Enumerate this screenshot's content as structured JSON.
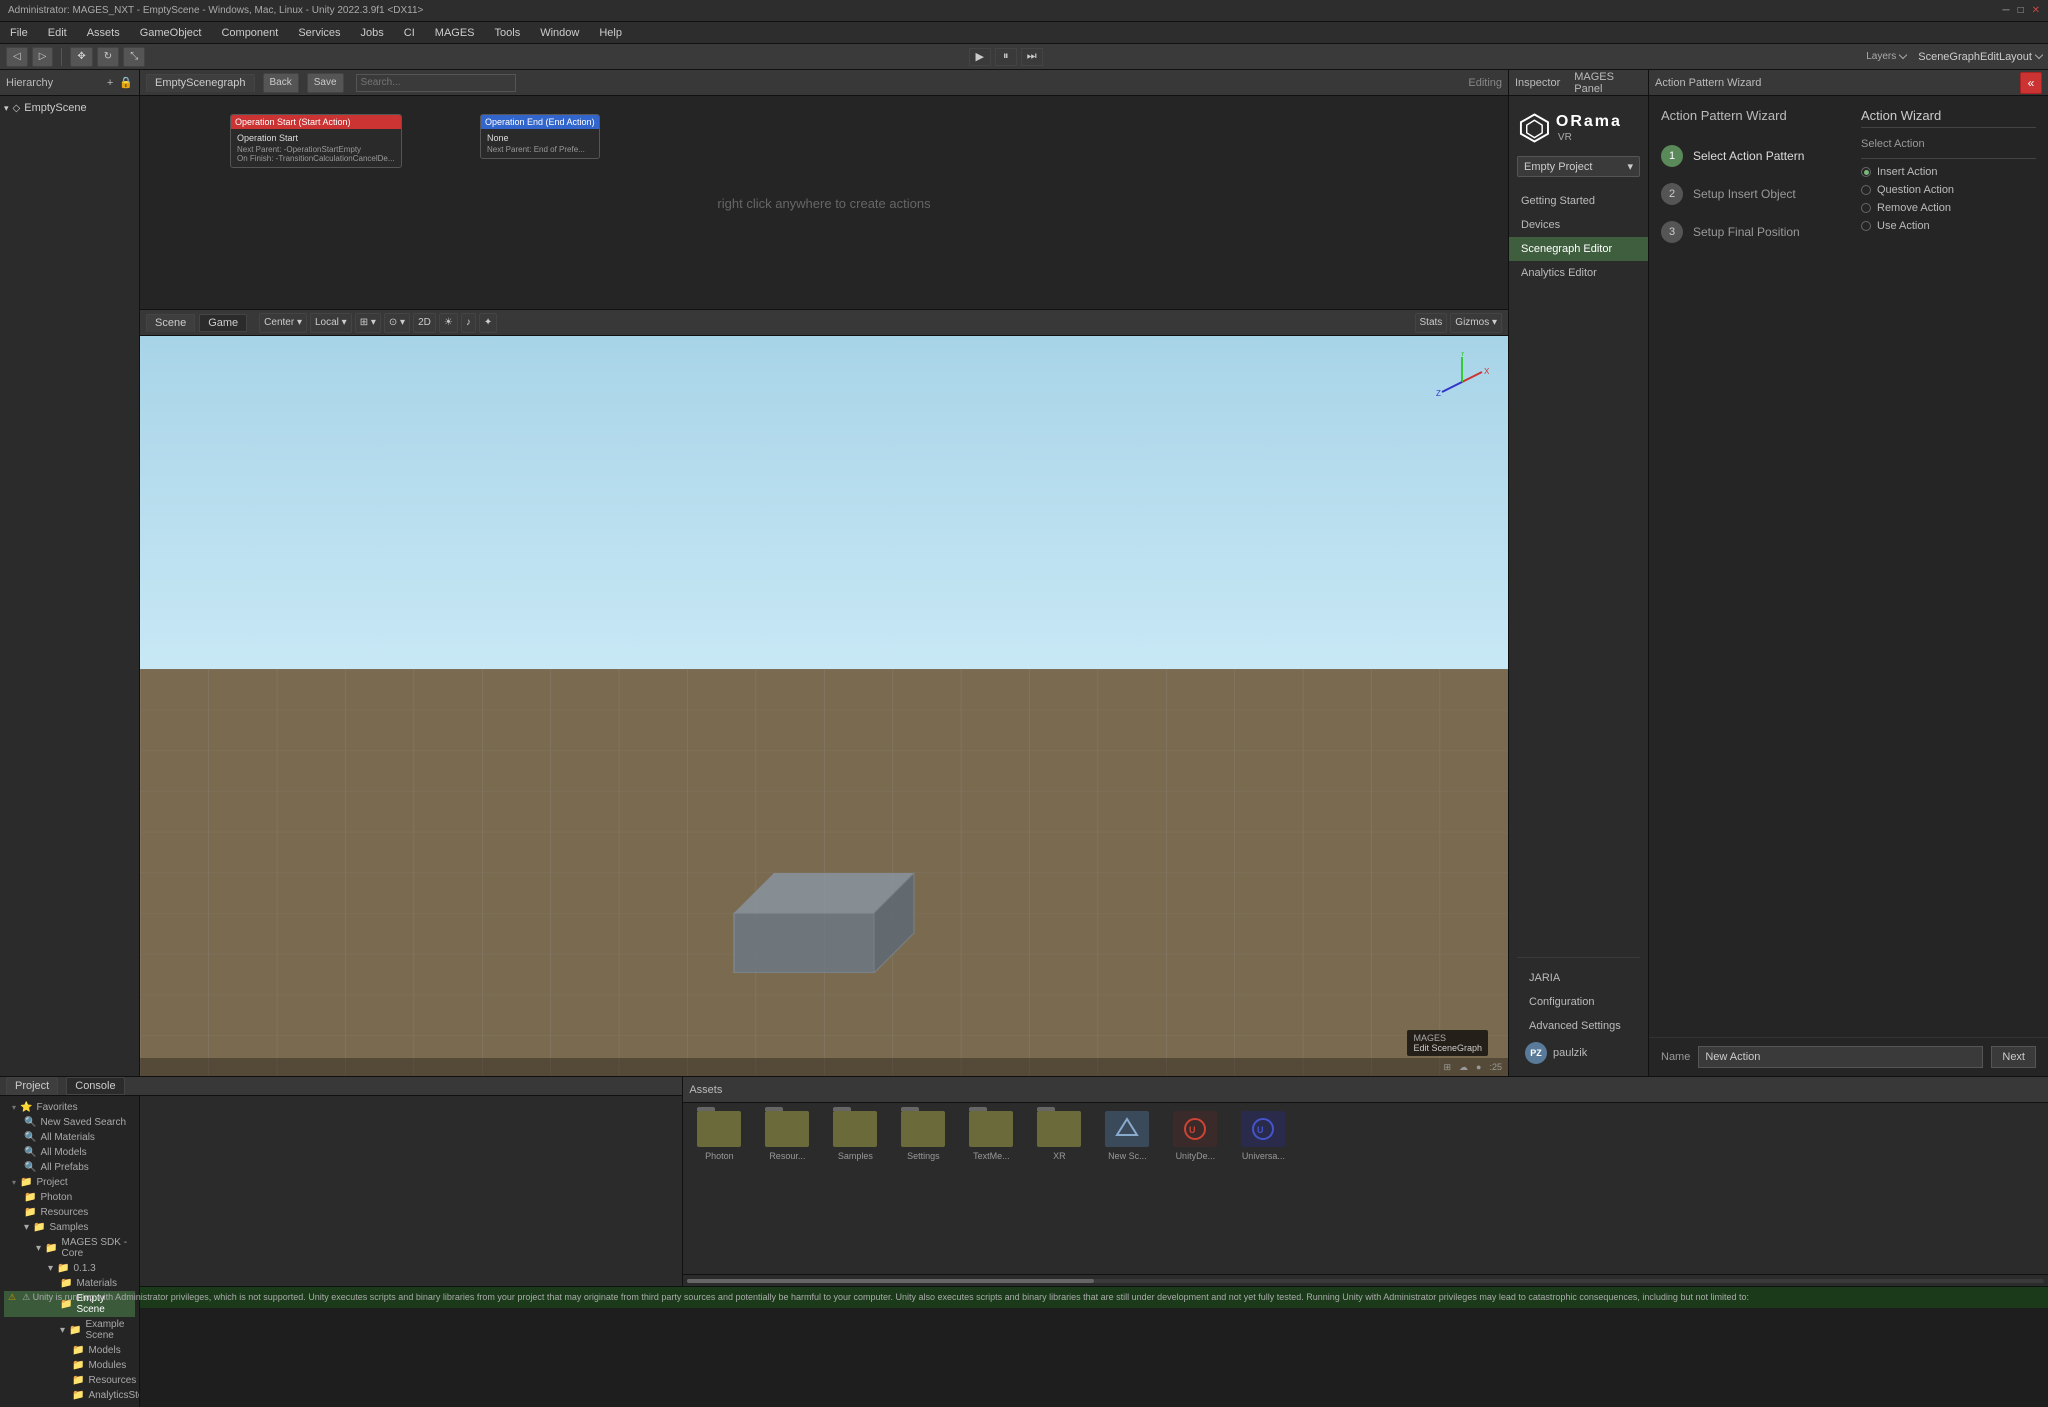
{
  "titlebar": {
    "text": "Administrator: MAGES_NXT - EmptyScene - Windows, Mac, Linux - Unity 2022.3.9f1 <DX11>"
  },
  "menubar": {
    "items": [
      "File",
      "Edit",
      "Assets",
      "GameObject",
      "Component",
      "Services",
      "Jobs",
      "CI",
      "MAGES",
      "Tools",
      "Window",
      "Help"
    ]
  },
  "toolbar": {
    "buttons": [
      "⟨",
      "⟩"
    ],
    "layers_label": "Layers",
    "layout_label": "SceneGraphEditLayout"
  },
  "hierarchy": {
    "title": "Hierarchy",
    "items": [
      {
        "label": "EmptyScene",
        "icon": "◇"
      }
    ]
  },
  "scenegraph": {
    "tab_scene": "Scene",
    "tab_game": "Game",
    "back_btn": "Back",
    "save_btn": "Save",
    "editing_label": "Editing",
    "hint": "right click anywhere to create actions",
    "node1": {
      "header": "Operation Start (Start Action)",
      "title": "Operation Start",
      "fields": [
        "Next Parent: -OperationStartEmpty",
        "On Finish: -TransitionCalculationCancelDe..."
      ]
    },
    "node2": {
      "header": "Operation End (End Action)",
      "title": "None",
      "fields": [
        "Next Parent: End of Prefe..."
      ]
    }
  },
  "scene_view": {
    "tabs": [
      "Scene",
      "Game"
    ],
    "gizmo": "axes"
  },
  "mages_panel": {
    "title": "MAGES Panel",
    "logo_text": "ORama",
    "logo_suffix": "VR",
    "project_label": "Empty Project",
    "nav_items": [
      {
        "label": "Getting Started",
        "active": false
      },
      {
        "label": "Devices",
        "active": false
      },
      {
        "label": "Scenegraph Editor",
        "active": true
      },
      {
        "label": "Analytics Editor",
        "active": false
      }
    ],
    "bottom_items": [
      {
        "label": "JARIA"
      },
      {
        "label": "Configuration"
      },
      {
        "label": "Advanced Settings"
      }
    ],
    "user_initials": "PZ",
    "user_name": "paulzik"
  },
  "inspector": {
    "title": "Inspector"
  },
  "wizard": {
    "title": "Action Pattern Wizard",
    "collapse_icon": "«",
    "steps": [
      {
        "num": "1",
        "label": "Select Action Pattern",
        "active": true
      },
      {
        "num": "2",
        "label": "Setup Insert Object",
        "active": false
      },
      {
        "num": "3",
        "label": "Setup Final Position",
        "active": false
      }
    ],
    "action_wizard_title": "Action Wizard",
    "select_action_label": "Select Action",
    "actions": [
      {
        "label": "Insert Action",
        "selected": true
      },
      {
        "label": "Question Action",
        "selected": false
      },
      {
        "label": "Remove Action",
        "selected": false
      },
      {
        "label": "Use Action",
        "selected": false
      }
    ],
    "name_label": "Name",
    "name_input_value": "New Action",
    "next_btn": "Next"
  },
  "bottom_tabs": {
    "project": "Project",
    "console": "Console"
  },
  "tree": {
    "favorites": {
      "label": "Favorites",
      "items": [
        "New Saved Search",
        "All Materials",
        "All Models",
        "All Prefabs"
      ]
    },
    "assets": {
      "label": "Assets",
      "items": [
        {
          "label": "Photon",
          "indent": 1
        },
        {
          "label": "Resources",
          "indent": 1
        },
        {
          "label": "Samples",
          "indent": 1
        },
        {
          "label": "MAGES SDK - Core",
          "indent": 2
        },
        {
          "label": "0.1.3",
          "indent": 3
        },
        {
          "label": "Materials",
          "indent": 4
        },
        {
          "label": "Empty Scene",
          "indent": 4
        },
        {
          "label": "Example Scene",
          "indent": 4
        },
        {
          "label": "Models",
          "indent": 5
        },
        {
          "label": "Modules",
          "indent": 5
        },
        {
          "label": "Resources",
          "indent": 5
        },
        {
          "label": "AnalyticsStor...",
          "indent": 5
        }
      ]
    }
  },
  "assets_grid": {
    "items": [
      {
        "label": "Photon",
        "type": "folder"
      },
      {
        "label": "Resour...",
        "type": "folder"
      },
      {
        "label": "Samples",
        "type": "folder"
      },
      {
        "label": "Settings",
        "type": "folder"
      },
      {
        "label": "TextMe...",
        "type": "folder"
      },
      {
        "label": "XR",
        "type": "folder"
      },
      {
        "label": "New Sc...",
        "type": "unity"
      },
      {
        "label": "UnityDe...",
        "type": "special_red"
      },
      {
        "label": "Universa...",
        "type": "special_blue"
      }
    ]
  },
  "statusbar": {
    "text": "⚠ Unity is running with Administrator privileges, which is not supported. Unity executes scripts and binary libraries from your project that may originate from third party sources and potentially be harmful to your computer. Unity also executes scripts and binary libraries that are still under development and not yet fully tested. Running Unity with Administrator privileges may lead to catastrophic consequences, including but not limited to:"
  }
}
